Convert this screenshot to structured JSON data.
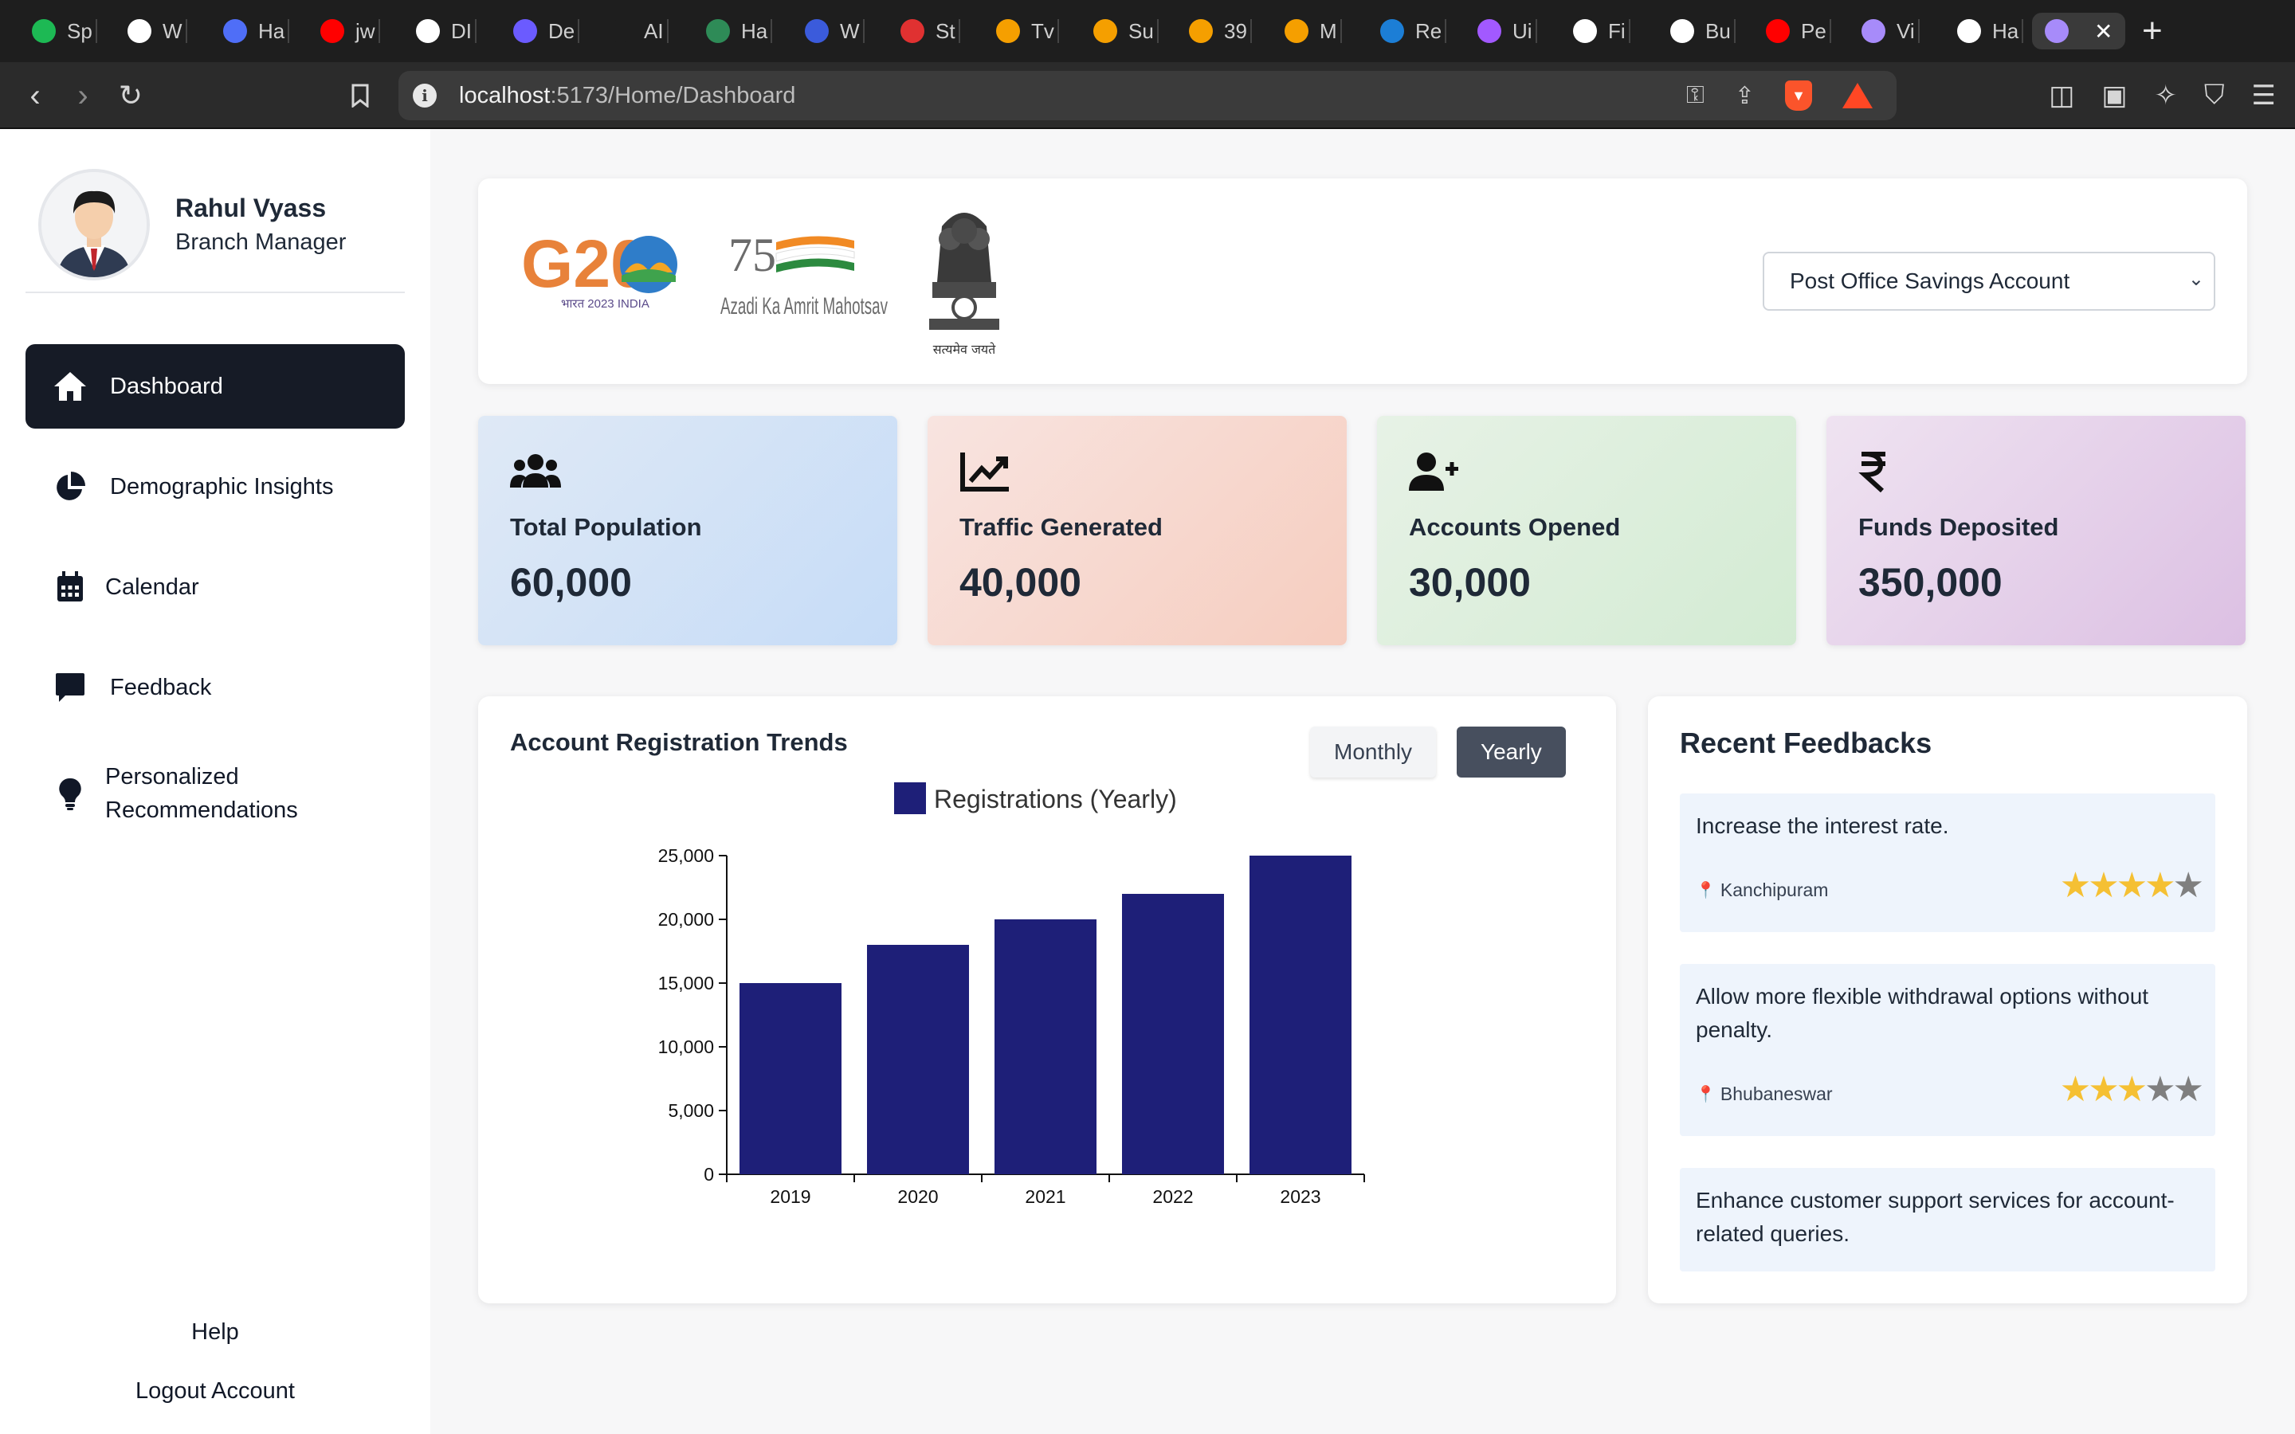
{
  "browser": {
    "tabs": [
      {
        "label": "Sp",
        "color": "#1db954"
      },
      {
        "label": "W",
        "color": "#ffffff"
      },
      {
        "label": "Ha",
        "color": "#4f6ef7"
      },
      {
        "label": "jw",
        "color": "#ff0000"
      },
      {
        "label": "DI",
        "color": "#ffffff"
      },
      {
        "label": "De",
        "color": "#6b5bff"
      },
      {
        "label": "AI",
        "color": "#1e1e1e"
      },
      {
        "label": "Ha",
        "color": "#2e8b57"
      },
      {
        "label": "W",
        "color": "#3b5bdb"
      },
      {
        "label": "St",
        "color": "#e03131"
      },
      {
        "label": "Tv",
        "color": "#f59f00"
      },
      {
        "label": "Su",
        "color": "#f59f00"
      },
      {
        "label": "39",
        "color": "#f59f00"
      },
      {
        "label": "M",
        "color": "#f59f00"
      },
      {
        "label": "Re",
        "color": "#1c7ed6"
      },
      {
        "label": "Ui",
        "color": "#a259ff"
      },
      {
        "label": "Fi",
        "color": "#ffffff"
      },
      {
        "label": "Bu",
        "color": "#ffffff"
      },
      {
        "label": "Pe",
        "color": "#ff0000"
      },
      {
        "label": "Vi",
        "color": "#a78bfa"
      },
      {
        "label": "Ha",
        "color": "#ffffff"
      }
    ],
    "url_host": "localhost",
    "url_path": ":5173/Home/Dashboard"
  },
  "sidebar": {
    "user_name": "Rahul Vyass",
    "user_role": "Branch Manager",
    "items": [
      {
        "label": "Dashboard"
      },
      {
        "label": "Demographic Insights"
      },
      {
        "label": "Calendar"
      },
      {
        "label": "Feedback"
      },
      {
        "label": "Personalized Recommendations"
      }
    ],
    "help": "Help",
    "logout": "Logout Account"
  },
  "header": {
    "account_select": "Post Office Savings Account",
    "logo_g20_text": "G20",
    "logo_g20_sub": "भारत 2023 INDIA",
    "logo_azadi_num": "75",
    "logo_azadi_text": "Azadi Ka Amrit Mahotsav",
    "emblem_motto": "सत्यमेव जयते"
  },
  "stats": [
    {
      "label": "Total Population",
      "value": "60,000"
    },
    {
      "label": "Traffic Generated",
      "value": "40,000"
    },
    {
      "label": "Accounts Opened",
      "value": "30,000"
    },
    {
      "label": "Funds Deposited",
      "value": "350,000"
    }
  ],
  "chart_card": {
    "title": "Account Registration Trends",
    "toggle_monthly": "Monthly",
    "toggle_yearly": "Yearly"
  },
  "chart_data": {
    "type": "bar",
    "categories": [
      "2019",
      "2020",
      "2021",
      "2022",
      "2023"
    ],
    "series": [
      {
        "name": "Registrations (Yearly)",
        "values": [
          15000,
          18000,
          20000,
          22000,
          25000
        ]
      }
    ],
    "ylim": [
      0,
      25000
    ],
    "yticks": [
      "0",
      "5,000",
      "10,000",
      "15,000",
      "20,000",
      "25,000"
    ],
    "bar_color": "#1e1f78",
    "legend": "top"
  },
  "feedbacks": {
    "title": "Recent Feedbacks",
    "items": [
      {
        "text": "Increase the interest rate.",
        "location": "Kanchipuram",
        "rating": 4
      },
      {
        "text": "Allow more flexible withdrawal options without penalty.",
        "location": "Bhubaneswar",
        "rating": 3
      },
      {
        "text": "Enhance customer support services for account-related queries.",
        "location": "",
        "rating": 0
      }
    ]
  }
}
